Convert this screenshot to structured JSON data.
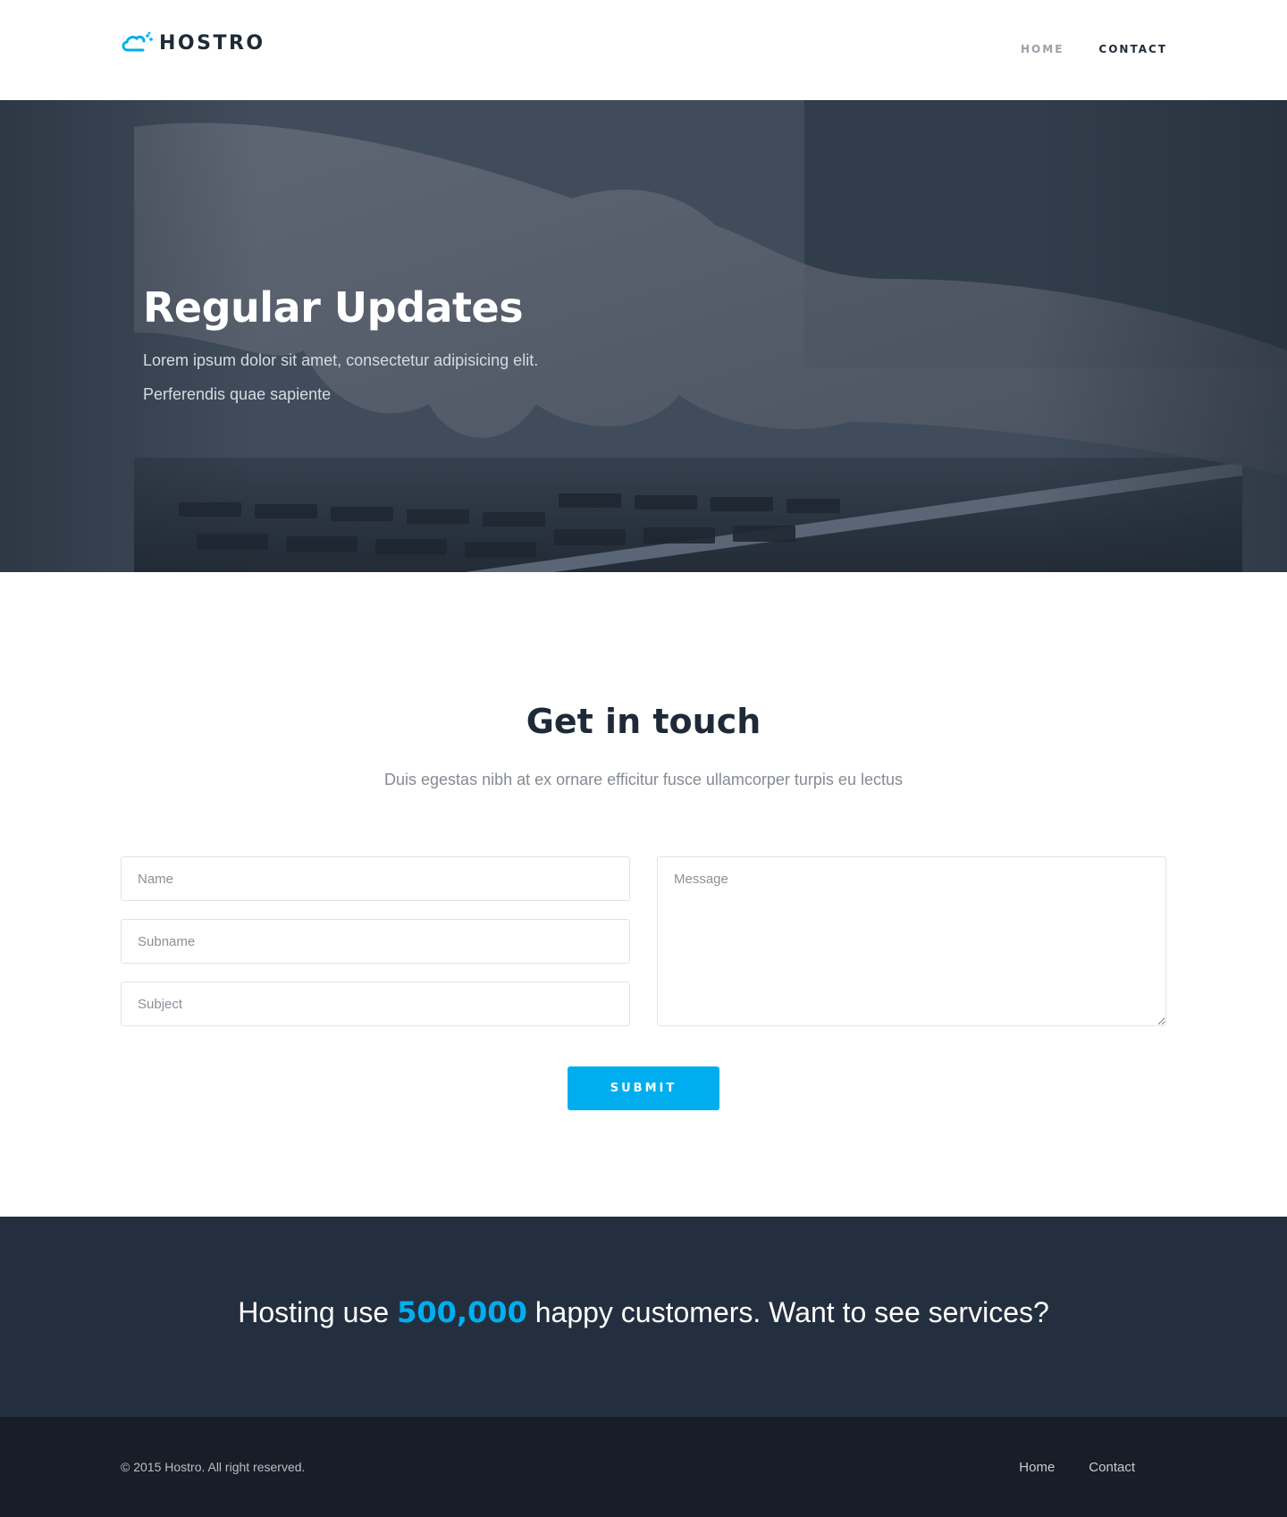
{
  "header": {
    "logo_text": "HOSTRO",
    "nav": [
      {
        "label": "HOME"
      },
      {
        "label": "CONTACT"
      }
    ]
  },
  "hero": {
    "title": "Regular Updates",
    "line1": "Lorem ipsum dolor sit amet, consectetur adipisicing elit.",
    "line2": "Perferendis quae sapiente"
  },
  "contact": {
    "title": "Get in touch",
    "subtitle": "Duis egestas nibh at ex ornare efficitur fusce ullamcorper turpis eu lectus",
    "fields": {
      "name_placeholder": "Name",
      "subname_placeholder": "Subname",
      "subject_placeholder": "Subject",
      "message_placeholder": "Message"
    },
    "submit_label": "SUBMIT"
  },
  "cta": {
    "prefix": "Hosting use ",
    "number": "500,000",
    "suffix": " happy customers. Want to see services?"
  },
  "footer": {
    "copyright": "© 2015 Hostro. All right reserved.",
    "links": [
      {
        "label": "Home"
      },
      {
        "label": "Contact"
      }
    ]
  },
  "colors": {
    "accent": "#00aeef",
    "dark_text": "#1f2a38",
    "cta_bg": "#232f3f",
    "footer_bg": "#181e27"
  }
}
